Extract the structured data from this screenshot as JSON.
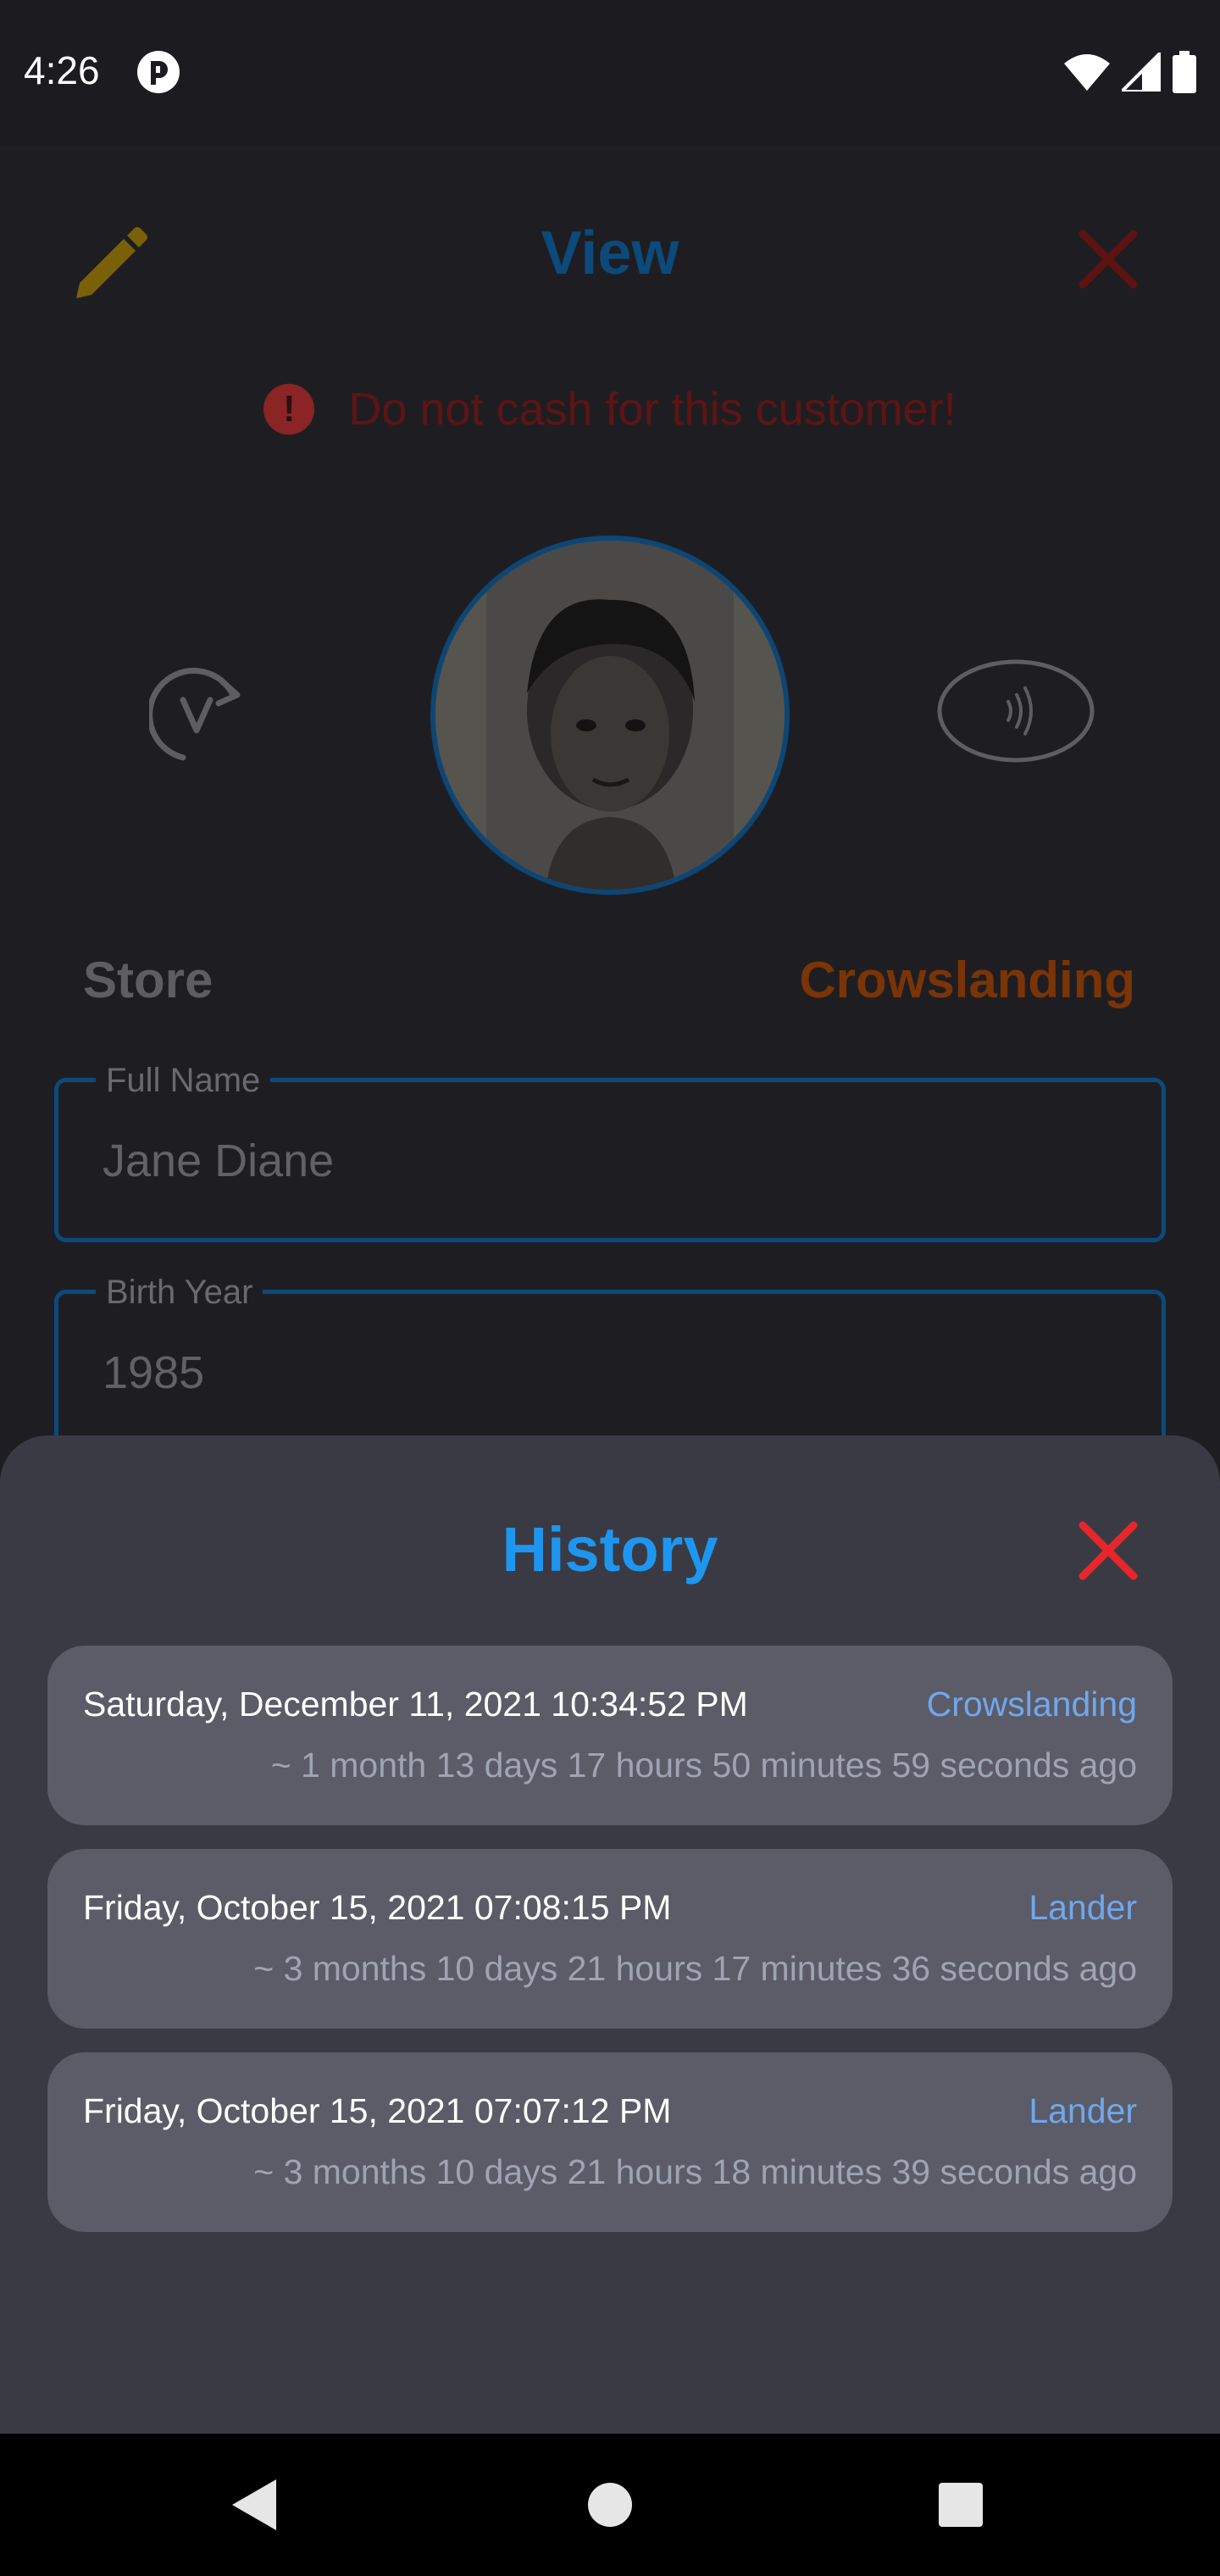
{
  "status_bar": {
    "time": "4:26",
    "icons": [
      "app-notification-icon",
      "wifi-icon",
      "cell-signal-icon",
      "battery-icon"
    ]
  },
  "page": {
    "title": "View",
    "warning": "Do not cash for this customer!",
    "store_label": "Store",
    "store_value": "Crowslanding",
    "full_name": {
      "label": "Full Name",
      "value": "Jane Diane"
    },
    "birth_year": {
      "label": "Birth Year",
      "value": "1985"
    },
    "icons": [
      "pencil-icon",
      "close-icon",
      "rotate-verify-icon",
      "nfc-contactless-icon"
    ]
  },
  "history": {
    "title": "History",
    "items": [
      {
        "date": "Saturday, December 11, 2021 10:34:52 PM",
        "store": "Crowslanding",
        "ago": "~ 1 month 13 days 17 hours 50 minutes 59 seconds ago"
      },
      {
        "date": "Friday, October 15, 2021 07:08:15 PM",
        "store": "Lander",
        "ago": "~ 3 months 10 days 21 hours 17 minutes 36 seconds ago"
      },
      {
        "date": "Friday, October 15, 2021 07:07:12 PM",
        "store": "Lander",
        "ago": "~ 3 months 10 days 21 hours 18 minutes 39 seconds ago"
      }
    ]
  },
  "colors": {
    "accent": "#1e96f0",
    "close_red": "#e8262a",
    "store_link": "#6fa8ec",
    "sheet_bg": "#3a3a44",
    "card_bg": "#5c5b68"
  }
}
